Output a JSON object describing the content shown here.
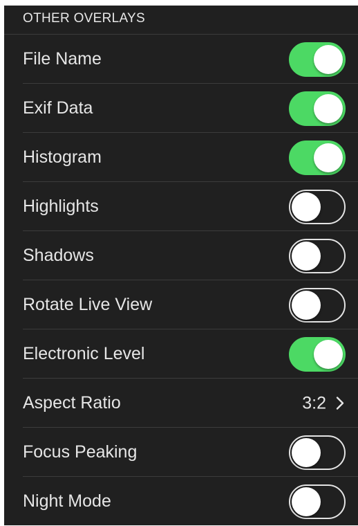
{
  "section": {
    "header": "OTHER OVERLAYS"
  },
  "colors": {
    "panel_background": "#202020",
    "toggle_on": "#4cd964",
    "toggle_off_border": "#e4e4e4",
    "separator": "#3c3c3c",
    "text": "#e6e6e6"
  },
  "rows": [
    {
      "label": "File Name",
      "control": "toggle",
      "on": true
    },
    {
      "label": "Exif Data",
      "control": "toggle",
      "on": true
    },
    {
      "label": "Histogram",
      "control": "toggle",
      "on": true
    },
    {
      "label": "Highlights",
      "control": "toggle",
      "on": false
    },
    {
      "label": "Shadows",
      "control": "toggle",
      "on": false
    },
    {
      "label": "Rotate Live View",
      "control": "toggle",
      "on": false
    },
    {
      "label": "Electronic Level",
      "control": "toggle",
      "on": true
    },
    {
      "label": "Aspect Ratio",
      "control": "disclosure",
      "value": "3:2",
      "icon": "chevron-right-icon"
    },
    {
      "label": "Focus Peaking",
      "control": "toggle",
      "on": false
    },
    {
      "label": "Night Mode",
      "control": "toggle",
      "on": false
    }
  ]
}
